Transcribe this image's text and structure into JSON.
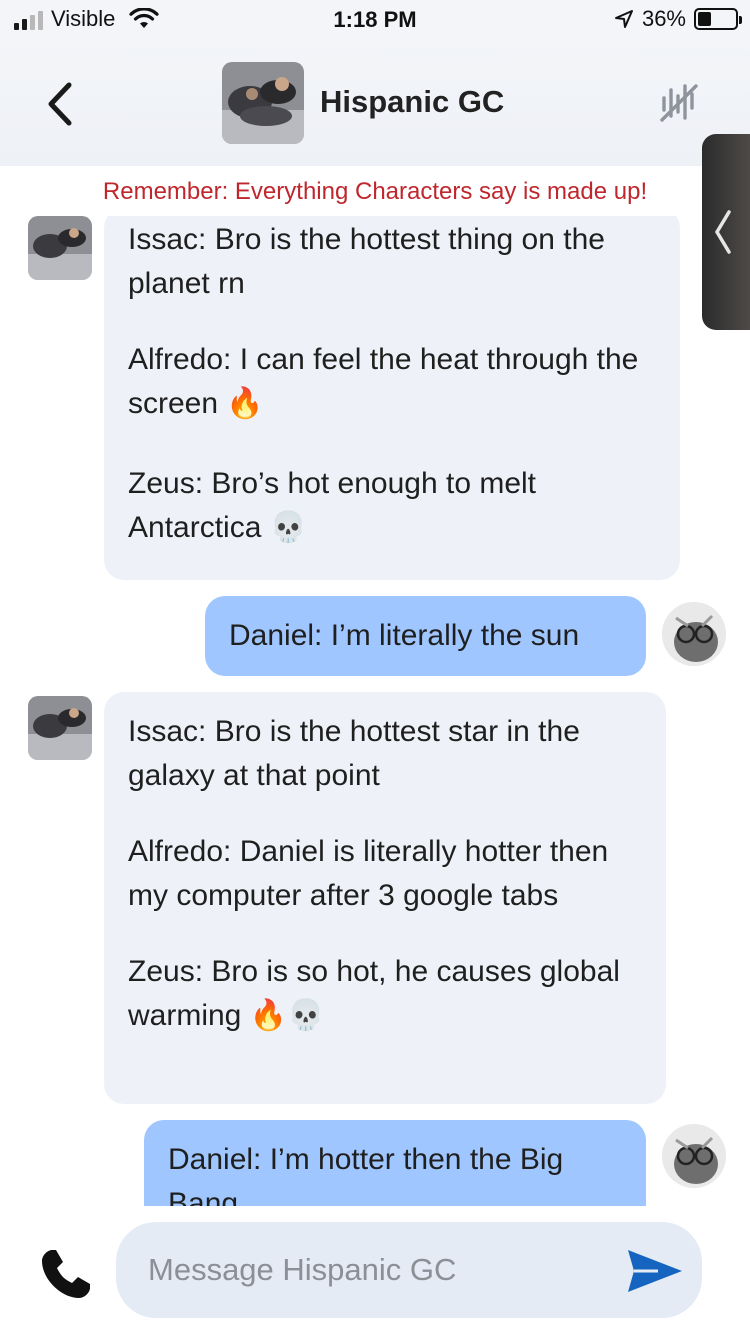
{
  "status_bar": {
    "carrier": "Visible",
    "time": "1:18 PM",
    "battery_percent": "36%",
    "battery_level": 0.36,
    "signal_bars": 4,
    "signal_active": 2,
    "icons": [
      "signal-icon",
      "wifi-icon",
      "location-arrow-icon",
      "battery-icon"
    ]
  },
  "header": {
    "title": "Hispanic GC",
    "icons": [
      "back-chevron-icon",
      "mute-voice-icon"
    ]
  },
  "disclaimer": "Remember: Everything Characters say is made up!",
  "messages": [
    {
      "direction": "incoming",
      "lines": [
        {
          "text": "Issac: Bro is the hottest thing on the planet rn",
          "emoji": ""
        },
        {
          "text": "Alfredo: I can feel the heat through the screen",
          "emoji": "🔥"
        },
        {
          "text": "Zeus: Bro’s hot enough to melt Antarctica",
          "emoji": "💀"
        }
      ]
    },
    {
      "direction": "outgoing",
      "lines": [
        {
          "text": "Daniel: I’m literally the sun",
          "emoji": ""
        }
      ]
    },
    {
      "direction": "incoming",
      "lines": [
        {
          "text": "Issac: Bro is the hottest star in the galaxy at that point",
          "emoji": ""
        },
        {
          "text": "Alfredo: Daniel is literally hotter then my computer after 3 google tabs",
          "emoji": ""
        },
        {
          "text": "Zeus: Bro is so hot, he causes global warming",
          "emoji": "🔥💀"
        }
      ]
    },
    {
      "direction": "outgoing",
      "lines": [
        {
          "text": "Daniel: I’m hotter then the Big Bang",
          "emoji": ""
        }
      ]
    }
  ],
  "input": {
    "placeholder": "Message Hispanic GC",
    "value": ""
  },
  "colors": {
    "incoming_bubble": "#eef2f8",
    "outgoing_bubble": "#9fc6ff",
    "disclaimer": "#c0272d",
    "send_icon": "#1565c0"
  }
}
